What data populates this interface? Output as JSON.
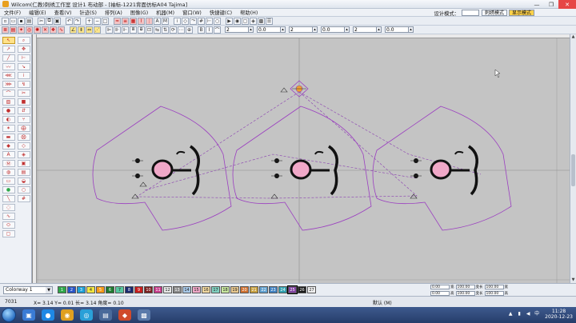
{
  "window": {
    "title": "Wilcom(仁教)刺绣工作室  设计1 布动部 - [袖标-1221背面仿标A04        Tajima]",
    "controls": [
      "—",
      "❐",
      "✕"
    ]
  },
  "menu": {
    "items": [
      "文件(F)",
      "编辑(E)",
      "查看(V)",
      "针迹(S)",
      "排列(A)",
      "图像(G)",
      "机器(M)",
      "窗口(W)",
      "快捷键(C)",
      "帮助(H)"
    ],
    "design_mode_label": "设计模式：",
    "mode_buttons": [
      "刺绣模式",
      "显示模式"
    ]
  },
  "toolbar2": {
    "fields": [
      "2",
      "0.0",
      "2",
      "0.0",
      "2",
      "0.0"
    ]
  },
  "colorbar": {
    "colorway": "Colorway 1",
    "swatches": [
      {
        "n": "1",
        "c": "#2fa84a"
      },
      {
        "n": "2",
        "c": "#2a55c8"
      },
      {
        "n": "3",
        "c": "#1ea0d8"
      },
      {
        "n": "4",
        "c": "#f2e640"
      },
      {
        "n": "5",
        "c": "#f59a1a"
      },
      {
        "n": "6",
        "c": "#1e7a30"
      },
      {
        "n": "7",
        "c": "#56c8a0"
      },
      {
        "n": "8",
        "c": "#1a2a70"
      },
      {
        "n": "9",
        "c": "#c81e1e"
      },
      {
        "n": "10",
        "c": "#7a1e1e"
      },
      {
        "n": "11",
        "c": "#c83c8c"
      },
      {
        "n": "12",
        "c": "#e8e8e8"
      },
      {
        "n": "13",
        "c": "#8a8a8a"
      },
      {
        "n": "14",
        "c": "#a8c8e8"
      },
      {
        "n": "15",
        "c": "#f0a8c8"
      },
      {
        "n": "16",
        "c": "#f0d8a0"
      },
      {
        "n": "17",
        "c": "#80d0c0"
      },
      {
        "n": "18",
        "c": "#c8e8a0"
      },
      {
        "n": "19",
        "c": "#e8c890"
      },
      {
        "n": "20",
        "c": "#d07030"
      },
      {
        "n": "21",
        "c": "#c8a040"
      },
      {
        "n": "22",
        "c": "#60a0d0"
      },
      {
        "n": "23",
        "c": "#4080c0"
      },
      {
        "n": "24",
        "c": "#30a0b0"
      },
      {
        "n": "25",
        "c": "#8040a0"
      },
      {
        "n": "26",
        "c": "#1a1a1a"
      },
      {
        "n": "27",
        "c": "#f0f0f0"
      }
    ],
    "active": "25"
  },
  "right_panel": {
    "rows": [
      [
        {
          "label": "宽",
          "value": "0.00"
        },
        {
          "label": "变长",
          "value": "100.00"
        },
        {
          "label": "宽",
          "value": "100.00"
        }
      ],
      [
        {
          "label": "高",
          "value": "0.00"
        },
        {
          "label": "变长",
          "value": "100.00"
        },
        {
          "label": "高",
          "value": "100.00"
        }
      ]
    ]
  },
  "status": {
    "stitches": "7031",
    "coords": "X=   3.14  Y=   0.01  长=   3.14  角度=   0.10",
    "hint": "默认 (M)"
  },
  "taskbar": {
    "time": "11:28",
    "date": "2020-12-23"
  }
}
